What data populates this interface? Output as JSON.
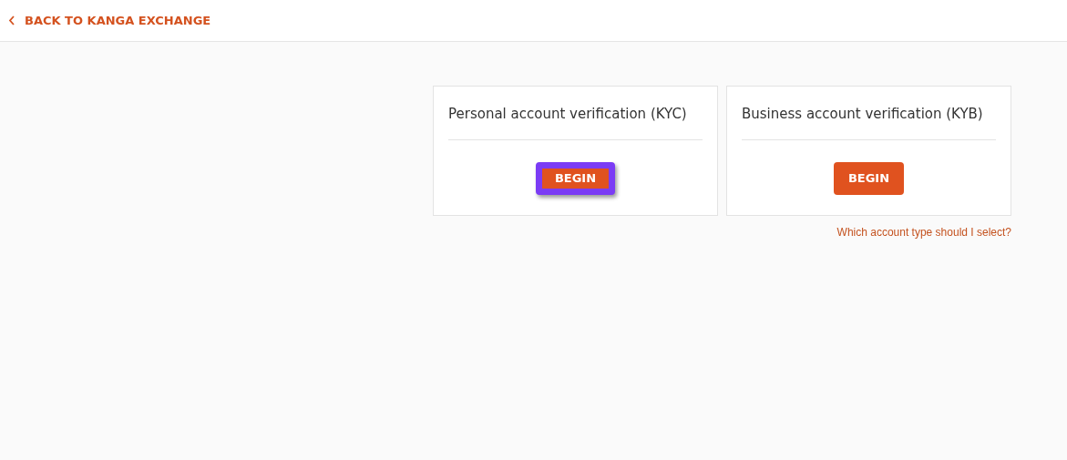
{
  "back_link": {
    "label": "BACK TO KANGA EXCHANGE"
  },
  "cards": [
    {
      "title": "Personal account verification (KYC)",
      "button": {
        "label": "BEGIN",
        "highlighted": true
      }
    },
    {
      "title": "Business account verification (KYB)",
      "button": {
        "label": "BEGIN",
        "highlighted": false
      }
    }
  ],
  "help_link": {
    "label": "Which account type should I select?"
  }
}
